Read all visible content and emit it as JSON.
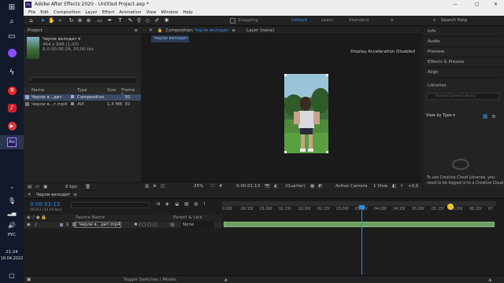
{
  "taskbar": {
    "lang": "РУС",
    "time": "21:24",
    "date": "16.04.2022"
  },
  "window": {
    "title": "Adobe After Effects 2020 - Untitled Project.aep *",
    "menu": [
      "File",
      "Edit",
      "Composition",
      "Layer",
      "Effect",
      "Animation",
      "View",
      "Window",
      "Help"
    ]
  },
  "toolbar": {
    "snapping": "Snapping",
    "workspaces": [
      "Default",
      "Learn",
      "Standard"
    ],
    "search_placeholder": "Search Help"
  },
  "project": {
    "tab": "Project",
    "item_name": "Черли велодит ▾",
    "item_info1": "464 x 848 (1,00)",
    "item_info2": "Δ 0:00:06:28, 30,00 fps",
    "search_placeholder": "⌕",
    "columns": [
      "Name",
      "Type",
      "Size",
      "Frame R..."
    ],
    "rows": [
      {
        "name": "Черли в...дит",
        "type": "Composition",
        "size": "",
        "fr": "30"
      },
      {
        "name": "Черли в...т.mp4",
        "type": "AVI",
        "size": "1,4 MB",
        "fr": "30"
      }
    ],
    "bpc": "8 bpc"
  },
  "composition": {
    "tab_label": "Composition",
    "tab_name": "Черли велодит",
    "layer_tab": "Layer (none)",
    "sub_tab": "Черли велодит",
    "gpu_msg": "Display Acceleration Disabled",
    "zoom": "25%",
    "timecode": "0:00:01:13",
    "resolution": "(Quarter)",
    "camera": "Active Camera",
    "view": "1 View",
    "exposure": "+0,0"
  },
  "right_panels": [
    "Info",
    "Audio",
    "Preview",
    "Effects & Presets",
    "Align",
    "Libraries"
  ],
  "libraries": {
    "search_placeholder": "Search Current Library",
    "view_by": "View by Type ▾",
    "msg1": "To use Creative Cloud Libraries, you",
    "msg2": "need to be logged in to a Creative Cloud"
  },
  "timeline": {
    "tab_name": "Черли велодит",
    "timecode": "0:00:03:13",
    "frames": "00103 (30.00 fps)",
    "col_source": "Source Name",
    "col_parent": "Parent & Link",
    "layer_num": "1",
    "layer_name": "Черли в...дит.mp4",
    "parent": "None",
    "ticks": [
      "0:00f",
      "00:15f",
      "01:00f",
      "01:15f",
      "02:00f",
      "02:15f",
      "03:00f",
      "03:15f",
      "04:00f",
      "04:15f",
      "05:00f",
      "05:15f",
      "06:00f",
      "06:15f",
      "07"
    ],
    "toggle": "Toggle Switches / Modes"
  },
  "colors": {
    "accent": "#2d8ceb",
    "layer_bar": "#6d9f63",
    "video_sky": "#8fb9cf"
  },
  "playhead_fraction": 0.51
}
